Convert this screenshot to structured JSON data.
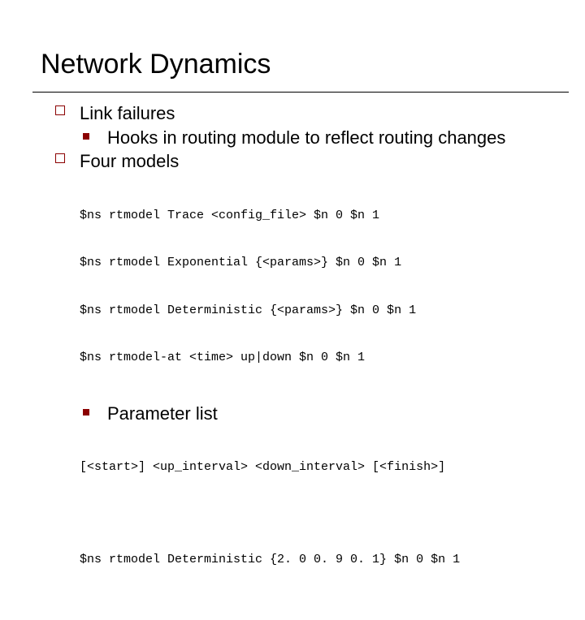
{
  "title": "Network Dynamics",
  "items": {
    "link_failures": "Link failures",
    "hooks": "Hooks in routing module to reflect routing changes",
    "four_models": "Four models",
    "parameter_list": "Parameter list"
  },
  "code": {
    "l1": "$ns rtmodel Trace <config_file> $n 0 $n 1",
    "l2": "$ns rtmodel Exponential {<params>} $n 0 $n 1",
    "l3": "$ns rtmodel Deterministic {<params>} $n 0 $n 1",
    "l4": "$ns rtmodel-at <time> up|down $n 0 $n 1",
    "p1": "[<start>] <up_interval> <down_interval> [<finish>]",
    "p2": "$ns rtmodel Deterministic {2. 0 0. 9 0. 1} $n 0 $n 1"
  }
}
